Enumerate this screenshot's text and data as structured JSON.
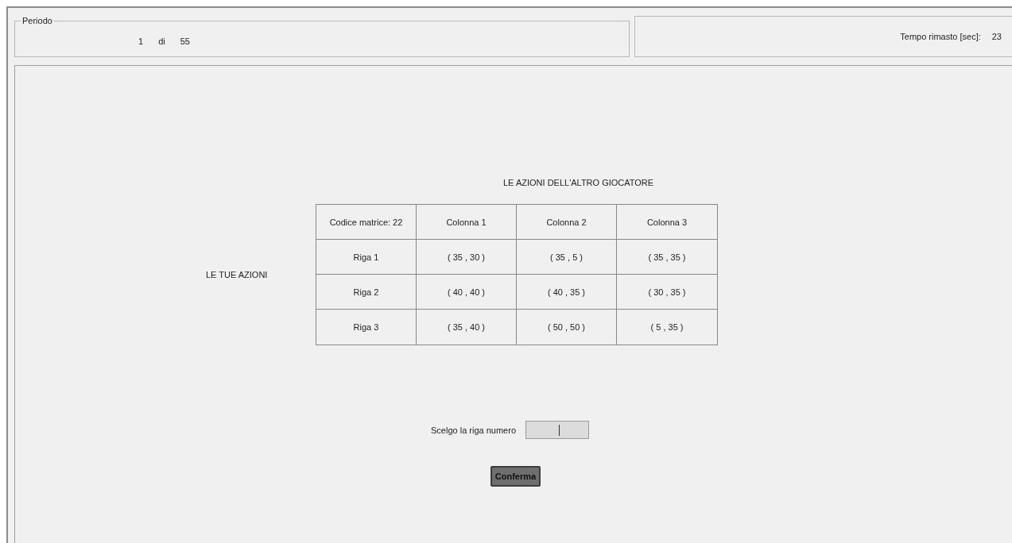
{
  "period": {
    "legend": "Periodo",
    "current": "1",
    "separator": "di",
    "total": "55"
  },
  "timer": {
    "label": "Tempo rimasto [sec]:",
    "value": "23"
  },
  "matrix": {
    "title": "LE AZIONI DELL'ALTRO GIOCATORE",
    "side_label": "LE TUE AZIONI",
    "columns": [
      "Codice matrice: 22",
      "Colonna 1",
      "Colonna 2",
      "Colonna 3"
    ],
    "rows": [
      [
        "Riga 1",
        "( 35 , 30 )",
        "( 35 , 5 )",
        "( 35 , 35 )"
      ],
      [
        "Riga 2",
        "( 40 , 40 )",
        "( 40 , 35 )",
        "( 30 , 35 )"
      ],
      [
        "Riga 3",
        "( 35 , 40 )",
        "( 50 , 50 )",
        "( 5 , 35 )"
      ]
    ]
  },
  "choice": {
    "label": "Scelgo la riga numero",
    "focused": true
  },
  "confirm_button": "Conferma"
}
